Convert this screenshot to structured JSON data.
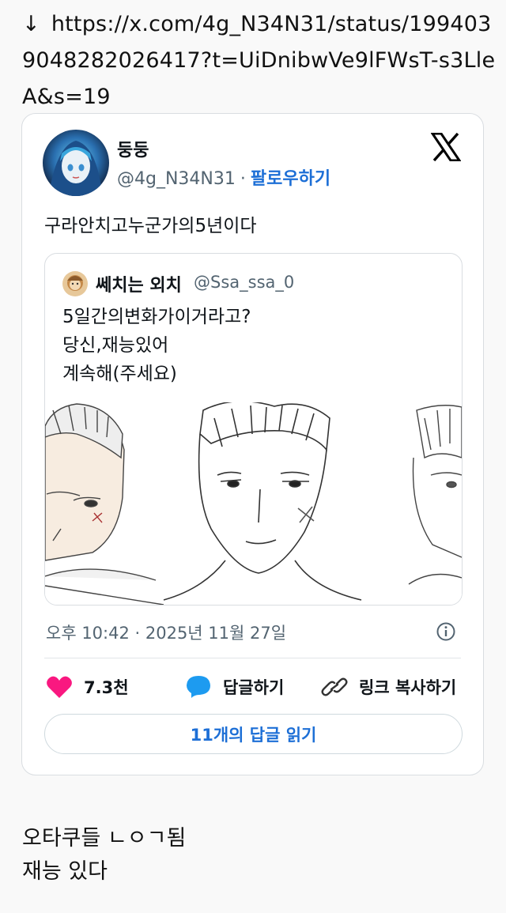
{
  "page": {
    "url_icon": "down-arrow-icon",
    "url_text": "https://x.com/4g_N34N31/status/1994039048282026417?t=UiDnibwVe9lFWsT-s3LleA&s=19",
    "caption_lines": [
      "오타쿠들 ㄴㅇㄱ됨",
      "재능 있다"
    ]
  },
  "tweet": {
    "author_name": "둥둥",
    "author_handle": "@4g_N34N31",
    "separator": "·",
    "follow_label": "팔로우하기",
    "text": "구라안치고누군가의5년이다",
    "timestamp": "오후 10:42 · 2025년 11월 27일",
    "quote": {
      "name": "쎄치는 외치",
      "handle": "@Ssa_ssa_0",
      "lines": [
        "5일간의변화가이거라고?",
        "당신,재능있어",
        "계속해(주세요)"
      ]
    },
    "actions": {
      "like_count": "7.3천",
      "reply_label": "답글하기",
      "copy_label": "링크 복사하기"
    },
    "read_replies_label": "11개의 답글 읽기"
  },
  "colors": {
    "link_blue": "#1d6fd6",
    "like_pink": "#f91880",
    "reply_blue": "#1d9bf0",
    "muted_text": "#536471"
  }
}
